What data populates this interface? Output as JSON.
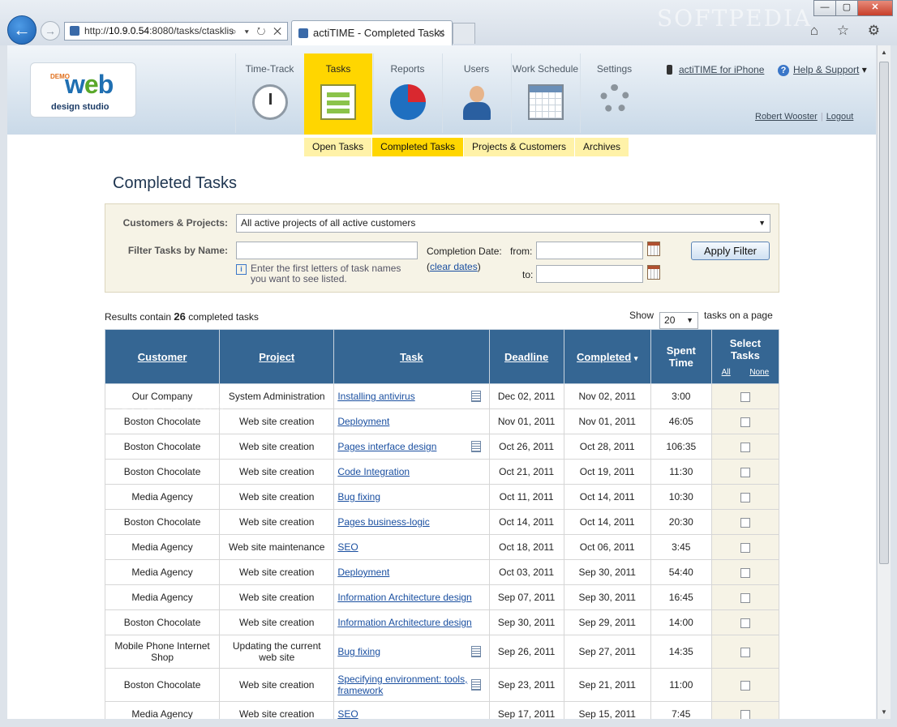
{
  "browser": {
    "url_prefix": "http://",
    "url_host": "10.9.0.54",
    "url_rest": ":8080/tasks/ctasklis",
    "url_tools": "⌕ ▾ ↻ ✕",
    "tab_title": "actiTIME - Completed Tasks",
    "tab_close": "✕",
    "watermark": "SOFTPEDIA",
    "win_min": "—",
    "win_max": "▢",
    "win_close": "✕",
    "icons": "⌂ ☆ ⚙"
  },
  "header": {
    "logo_demo": "DEMO",
    "logo_web_w": "w",
    "logo_web_e": "e",
    "logo_web_b": "b",
    "logo_sub": "design studio",
    "nav": [
      {
        "label": "Time-Track",
        "icon": "stopwatch-icon"
      },
      {
        "label": "Tasks",
        "icon": "clipboard-icon"
      },
      {
        "label": "Reports",
        "icon": "pie-chart-icon"
      },
      {
        "label": "Users",
        "icon": "user-icon"
      },
      {
        "label": "Work Schedule",
        "icon": "calendar-icon"
      },
      {
        "label": "Settings",
        "icon": "gears-icon"
      }
    ],
    "iphone_link": "actiTIME for iPhone",
    "help_link": "Help & Support",
    "help_arrow": "▾",
    "user_name": "Robert Wooster",
    "logout": "Logout",
    "separator": "|"
  },
  "subnav": [
    "Open Tasks",
    "Completed Tasks",
    "Projects & Customers",
    "Archives"
  ],
  "page_title": "Completed Tasks",
  "filter": {
    "customers_label": "Customers & Projects:",
    "customers_value": "All active projects of all active customers",
    "name_label": "Filter Tasks by Name:",
    "name_value": "",
    "hint": "Enter the first letters of task names you want to see listed.",
    "completion_label": "Completion Date:",
    "from_label": "from:",
    "to_label": "to:",
    "from_value": "",
    "to_value": "",
    "clear_open": "(",
    "clear_dates": "clear dates",
    "clear_close": ")",
    "apply_button": "Apply Filter"
  },
  "results": {
    "prefix": "Results contain",
    "count": "26",
    "suffix": "completed tasks",
    "show_label": "Show",
    "page_size": "20",
    "page_suffix": "tasks on a page"
  },
  "table": {
    "headers": {
      "customer": "Customer",
      "project": "Project",
      "task": "Task",
      "deadline": "Deadline",
      "completed": "Completed",
      "sort_arrow": "▾",
      "spent_time_1": "Spent",
      "spent_time_2": "Time",
      "select_tasks_1": "Select",
      "select_tasks_2": "Tasks",
      "all": "All",
      "none": "None"
    },
    "watermark": "SOFTPEDIA",
    "rows": [
      {
        "customer": "Our Company",
        "project": "System Administration",
        "task": "Installing antivirus",
        "note": true,
        "deadline": "Dec 02, 2011",
        "completed": "Nov 02, 2011",
        "spent": "3:00"
      },
      {
        "customer": "Boston Chocolate",
        "project": "Web site creation",
        "task": "Deployment",
        "note": false,
        "deadline": "Nov 01, 2011",
        "completed": "Nov 01, 2011",
        "spent": "46:05"
      },
      {
        "customer": "Boston Chocolate",
        "project": "Web site creation",
        "task": "Pages interface design",
        "note": true,
        "deadline": "Oct 26, 2011",
        "completed": "Oct 28, 2011",
        "spent": "106:35"
      },
      {
        "customer": "Boston Chocolate",
        "project": "Web site creation",
        "task": "Code Integration",
        "note": false,
        "deadline": "Oct 21, 2011",
        "completed": "Oct 19, 2011",
        "spent": "11:30"
      },
      {
        "customer": "Media Agency",
        "project": "Web site creation",
        "task": "Bug fixing",
        "note": false,
        "deadline": "Oct 11, 2011",
        "completed": "Oct 14, 2011",
        "spent": "10:30"
      },
      {
        "customer": "Boston Chocolate",
        "project": "Web site creation",
        "task": "Pages business-logic",
        "note": false,
        "deadline": "Oct 14, 2011",
        "completed": "Oct 14, 2011",
        "spent": "20:30"
      },
      {
        "customer": "Media Agency",
        "project": "Web site maintenance",
        "task": "SEO",
        "note": false,
        "deadline": "Oct 18, 2011",
        "completed": "Oct 06, 2011",
        "spent": "3:45"
      },
      {
        "customer": "Media Agency",
        "project": "Web site creation",
        "task": "Deployment",
        "note": false,
        "deadline": "Oct 03, 2011",
        "completed": "Sep 30, 2011",
        "spent": "54:40"
      },
      {
        "customer": "Media Agency",
        "project": "Web site creation",
        "task": "Information Architecture design",
        "note": false,
        "deadline": "Sep 07, 2011",
        "completed": "Sep 30, 2011",
        "spent": "16:45"
      },
      {
        "customer": "Boston Chocolate",
        "project": "Web site creation",
        "task": "Information Architecture design",
        "note": false,
        "deadline": "Sep 30, 2011",
        "completed": "Sep 29, 2011",
        "spent": "14:00"
      },
      {
        "customer": "Mobile Phone Internet Shop",
        "project": "Updating the current web site",
        "task": "Bug fixing",
        "note": true,
        "deadline": "Sep 26, 2011",
        "completed": "Sep 27, 2011",
        "spent": "14:35"
      },
      {
        "customer": "Boston Chocolate",
        "project": "Web site creation",
        "task": "Specifying environment: tools, framework",
        "note": true,
        "deadline": "Sep 23, 2011",
        "completed": "Sep 21, 2011",
        "spent": "11:00"
      },
      {
        "customer": "Media Agency",
        "project": "Web site creation",
        "task": "SEO",
        "note": false,
        "deadline": "Sep 17, 2011",
        "completed": "Sep 15, 2011",
        "spent": "7:45"
      }
    ]
  }
}
